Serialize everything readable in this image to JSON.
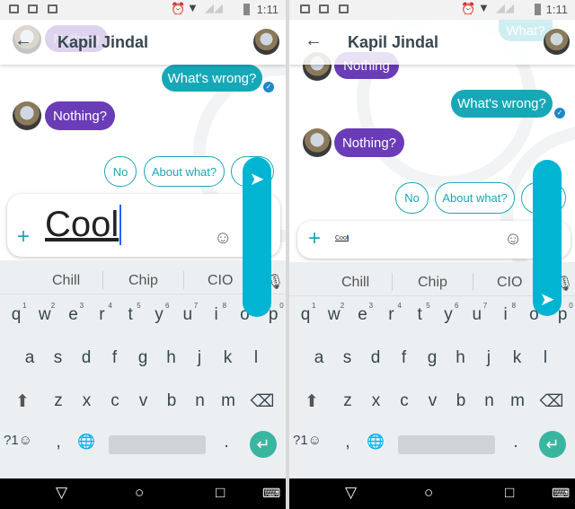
{
  "status": {
    "time": "1:11",
    "icons": [
      "image-icon",
      "gmail-icon",
      "clipboard-icon",
      "alarm-icon",
      "wifi-icon",
      "signal-icon",
      "battery-icon"
    ]
  },
  "contact": "Kapil Jindal",
  "messages": {
    "sent": "What's wrong?",
    "received": "Nothing?",
    "ghost_received": "Nothing",
    "ghost_sent": "What?"
  },
  "smart_replies": [
    "No",
    "About what?",
    "Y"
  ],
  "panel1": {
    "input": "Cool"
  },
  "panel2": {
    "input": "Cool"
  },
  "keyboard": {
    "suggestions": [
      "Chill",
      "Chip",
      "CIO"
    ],
    "row1": [
      "q",
      "w",
      "e",
      "r",
      "t",
      "y",
      "u",
      "i",
      "o",
      "p"
    ],
    "row1_hints": [
      "1",
      "2",
      "3",
      "4",
      "5",
      "6",
      "7",
      "8",
      "9",
      "0"
    ],
    "row2": [
      "a",
      "s",
      "d",
      "f",
      "g",
      "h",
      "j",
      "k",
      "l"
    ],
    "row3": [
      "z",
      "x",
      "c",
      "v",
      "b",
      "n",
      "m"
    ],
    "symbols": "?1☺",
    "comma": ",",
    "period": "."
  },
  "colors": {
    "sent": "#17a8b8",
    "received": "#6a3cb8",
    "fab": "#00b4d2",
    "enter": "#3ab5a0"
  }
}
